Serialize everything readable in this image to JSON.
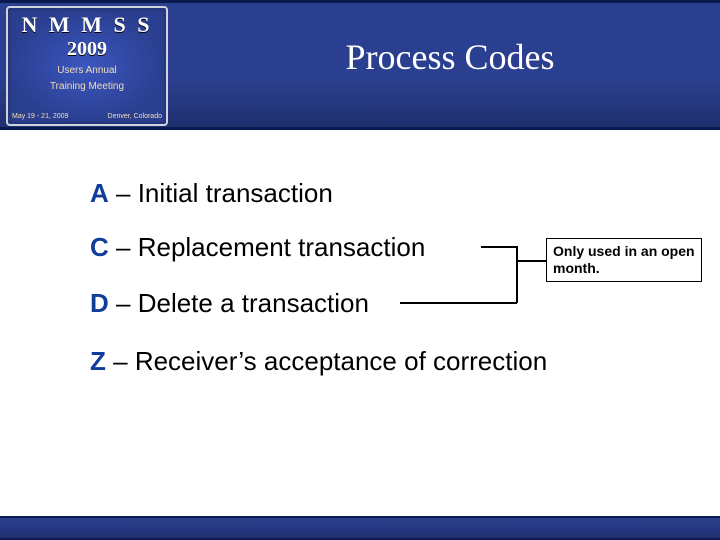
{
  "logo": {
    "word": "N M M S S",
    "year": "2009",
    "sub1": "Users Annual",
    "sub2": "Training Meeting",
    "date": "May 19 - 21, 2009",
    "place": "Denver, Colorado"
  },
  "title": "Process Codes",
  "items": {
    "a": {
      "code": "A",
      "sep": " – ",
      "text": "Initial transaction"
    },
    "c": {
      "code": "C",
      "sep": " – ",
      "text": "Replacement transaction"
    },
    "d": {
      "code": "D",
      "sep": " – ",
      "text": "Delete a transaction"
    },
    "z": {
      "code": "Z",
      "sep": " – ",
      "text": "Receiver’s acceptance of correction"
    }
  },
  "callout": "Only used in an open month."
}
